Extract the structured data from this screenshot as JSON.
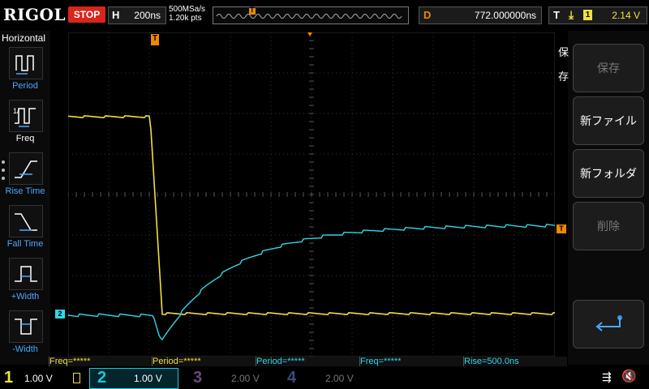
{
  "brand": "RIGOL",
  "run_state": "STOP",
  "horizontal": {
    "key": "H",
    "timebase": "200ns",
    "sample_rate": "500MSa/s",
    "mem_depth": "1.20k pts"
  },
  "trigger_pos_marker": "T",
  "delay": {
    "key": "D",
    "value": "772.000000ns"
  },
  "trigger": {
    "key": "T",
    "channel": "1",
    "level": "2.14 V"
  },
  "left_menu": {
    "title": "Horizontal",
    "items": [
      {
        "label": "Period",
        "icon": "period-icon"
      },
      {
        "label": "Freq",
        "icon": "frequency-icon"
      },
      {
        "label": "Rise Time",
        "icon": "rise-time-icon"
      },
      {
        "label": "Fall Time",
        "icon": "fall-time-icon"
      },
      {
        "label": "+Width",
        "icon": "positive-width-icon"
      },
      {
        "label": "-Width",
        "icon": "negative-width-icon"
      }
    ]
  },
  "right_menu": {
    "title": "保存",
    "buttons": [
      {
        "label": "保存",
        "enabled": false
      },
      {
        "label": "新ファイル",
        "enabled": true
      },
      {
        "label": "新フォルダ",
        "enabled": true
      },
      {
        "label": "削除",
        "enabled": false
      },
      {
        "label": "",
        "icon": "enter-icon",
        "enabled": true
      }
    ]
  },
  "measurements": [
    {
      "text": "Freq=*****",
      "channel": 1
    },
    {
      "text": "Period=*****",
      "channel": 1
    },
    {
      "text": "Period=*****",
      "channel": 2
    },
    {
      "text": "Freq=*****",
      "channel": 2
    },
    {
      "text": "Rise=500.0ns",
      "channel": 2
    }
  ],
  "channels": [
    {
      "num": "1",
      "scale": "1.00 V",
      "color": "#f0e040",
      "active": true
    },
    {
      "num": "2",
      "scale": "1.00 V",
      "color": "#1ac8dc",
      "active": true
    },
    {
      "num": "3",
      "scale": "2.00 V",
      "color": "#6a4a7a",
      "active": false
    },
    {
      "num": "4",
      "scale": "2.00 V",
      "color": "#3a4a7a",
      "active": false
    }
  ],
  "markers": {
    "ch2_ref": "2",
    "trigger_level": "T"
  },
  "colors": {
    "ch1": "#f0e040",
    "ch2": "#33d6e8",
    "stop": "#d9251c",
    "trigger": "#f08800",
    "menu_accent": "#4aa8ff"
  }
}
